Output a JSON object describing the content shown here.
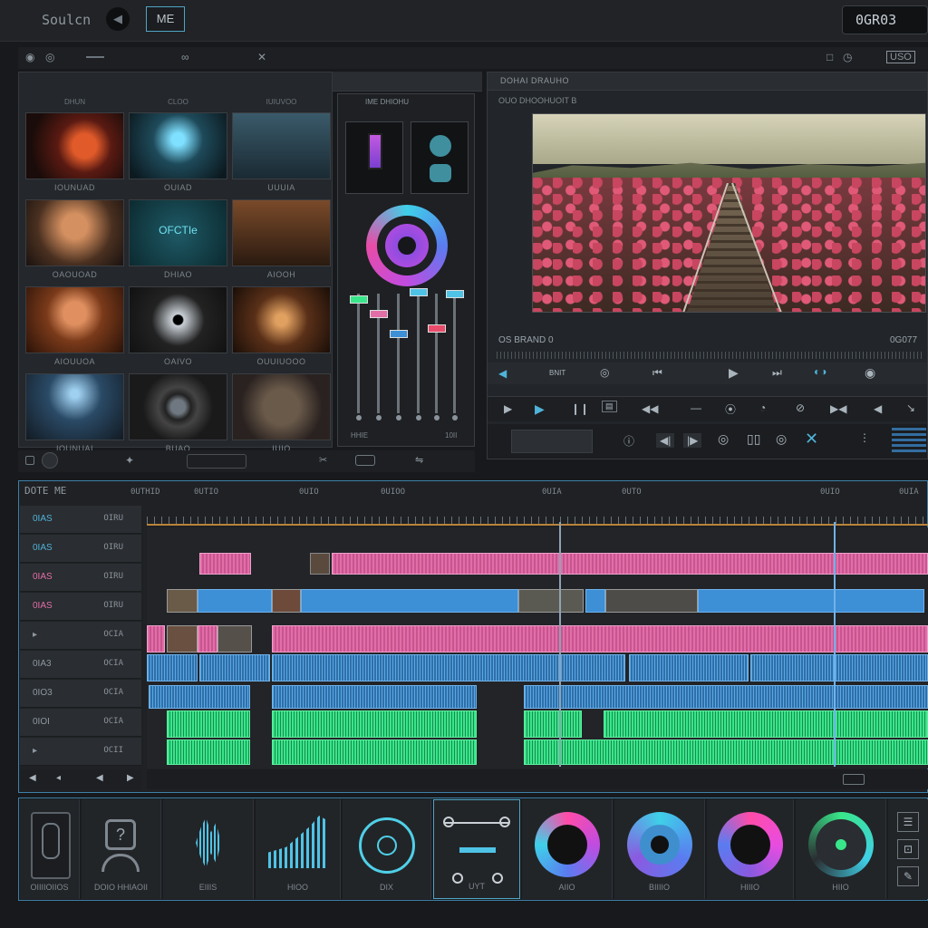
{
  "app": {
    "title": "Soulcn",
    "name_field": "ME",
    "timecode": "0GR03"
  },
  "toolbar2": {
    "right_label": "USO"
  },
  "media": {
    "items": [
      {
        "top": "DHUN",
        "label": "IOUNUAD"
      },
      {
        "top": "CLOO",
        "label": "OUIAD"
      },
      {
        "top": "IUIUVOO",
        "label": "UUUIA"
      },
      {
        "top": "",
        "label": "OAOUOAD"
      },
      {
        "top": "",
        "label": "DHIAO",
        "overlay": "OFCTIe"
      },
      {
        "top": "",
        "label": "AIOOH"
      },
      {
        "top": "",
        "label": "AIOUUOA"
      },
      {
        "top": "",
        "label": "OAIVO"
      },
      {
        "top": "",
        "label": "OUUIUOOO"
      },
      {
        "top": "",
        "label": "IOUNUAI"
      },
      {
        "top": "",
        "label": "BUAO"
      },
      {
        "top": "",
        "label": "IUIO"
      }
    ]
  },
  "mixer": {
    "title": "IME DHIOHU",
    "bottom_left": "HHIE",
    "bottom_right": "10II"
  },
  "viewer": {
    "title": "DOHAI DRAUHO",
    "subtitle": "OUO DHOOHUOIT B",
    "clip_name": "OS BRAND 0",
    "duration": "0G077",
    "transport_label": "BNIT"
  },
  "timeline": {
    "title": "DOTE ME",
    "ruler": [
      "0UTHID",
      "0UTIO",
      "0UIO",
      "0UIOO",
      "0UIA",
      "0UTO",
      "0UIO",
      "0UIA"
    ],
    "tracks": [
      {
        "label": "OIRU"
      },
      {
        "label": "OIRU"
      },
      {
        "label": "OIRU"
      },
      {
        "label": "OIRU"
      },
      {
        "label": "OCIA"
      },
      {
        "label": "OCIA"
      },
      {
        "label": "OCIA"
      },
      {
        "label": "OCIA"
      },
      {
        "label": "OCII"
      }
    ],
    "track_icons": [
      "0IAS",
      "0IAS",
      "0IAS",
      "0IAS",
      "",
      "0IA3",
      "0IO3",
      "0IOI",
      ""
    ]
  },
  "fx": {
    "labels": [
      "OIIIIOIIOS",
      "DOIO HHIAOII",
      "EIIIS",
      "HIOO",
      "DIX",
      "UYT",
      "AIIO",
      "BIIIIO",
      "HIIIO",
      "HIIO"
    ]
  },
  "colors": {
    "accent": "#3e7fa8",
    "pink": "#e26ea7",
    "blue": "#3d8fd6",
    "green": "#39e68a"
  }
}
